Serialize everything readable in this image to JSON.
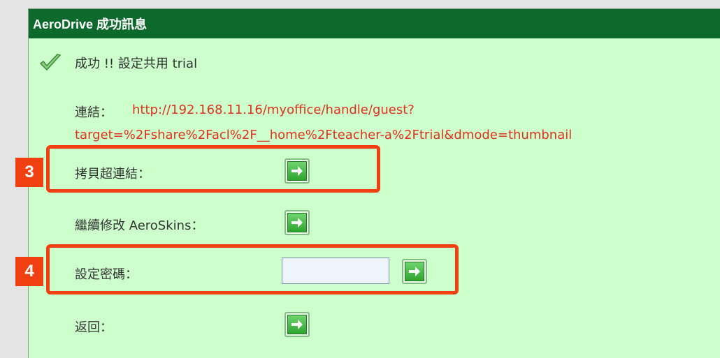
{
  "dialog": {
    "title": "AeroDrive 成功訊息",
    "success_message": "成功 !! 設定共用 trial"
  },
  "link": {
    "label": "連結：",
    "url_line1": "http://192.168.11.16/myoffice/handle/guest?",
    "url_line2": "target=%2Fshare%2Facl%2F__home%2Fteacher-a%2Ftrial&dmode=thumbnail"
  },
  "actions": {
    "copy_link_label": "拷貝超連結：",
    "continue_edit_label": "繼續修改 AeroSkins：",
    "set_password_label": "設定密碼：",
    "password_value": "",
    "back_label": "返回："
  },
  "annotations": {
    "badge_3": "3",
    "badge_4": "4",
    "accent_color": "#f04012"
  },
  "colors": {
    "titlebar": "#0e6a2c",
    "panel_background": "#ccffcc",
    "url_text": "#e0301e"
  }
}
